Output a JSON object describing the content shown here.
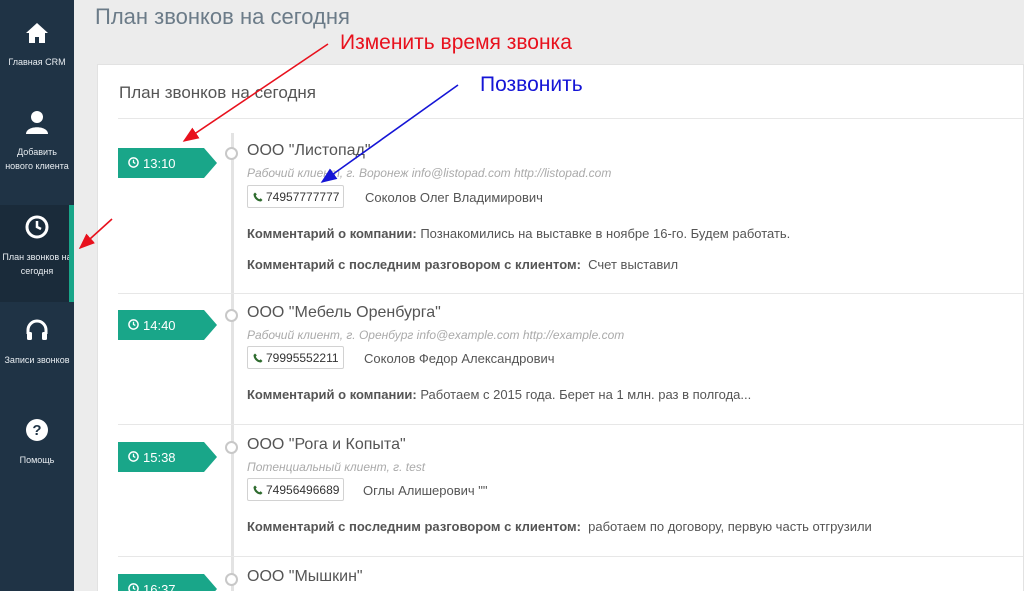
{
  "sidebar": {
    "items": [
      {
        "icon": "home-icon",
        "label": "Главная CRM"
      },
      {
        "icon": "user-icon",
        "label": "Добавить нового клиента"
      },
      {
        "icon": "clock-icon",
        "label": "План звонков на сегодня"
      },
      {
        "icon": "headphones-icon",
        "label": "Записи звонков"
      },
      {
        "icon": "question-icon",
        "label": "Помощь"
      }
    ],
    "accent": "#19a689",
    "background": "#1f3345"
  },
  "page": {
    "title": "План звонков на сегодня"
  },
  "panel": {
    "title": "План звонков на сегодня"
  },
  "annotations": {
    "change_time": "Изменить время звонка",
    "call": "Позвонить",
    "change_time_color": "#e8111d",
    "call_color": "#1515d6"
  },
  "calls": [
    {
      "time": "13:10",
      "company": "ООО \"Листопад\"",
      "meta": "Рабочий клиент, г. Воронеж info@listopad.com http://listopad.com",
      "phone": "74957777777",
      "contact": "Соколов Олег Владимирович",
      "company_comment_label": "Комментарий о компании:",
      "company_comment": "Познакомились на выставке в ноябре 16-го. Будем работать.",
      "last_comment_label": "Комментарий с последним разговором с клиентом:",
      "last_comment": "Счет выставил"
    },
    {
      "time": "14:40",
      "company": "ООО \"Мебель Оренбурга\"",
      "meta": "Рабочий клиент, г. Оренбург info@example.com http://example.com",
      "phone": "79995552211",
      "contact": "Соколов Федор Александрович",
      "company_comment_label": "Комментарий о компании:",
      "company_comment": "Работаем с 2015 года. Берет на 1 млн. раз в полгода..."
    },
    {
      "time": "15:38",
      "company": "ООО \"Рога и Копыта\"",
      "meta": "Потенциальный клиент, г. test",
      "phone": "74956496689",
      "contact": "Оглы Алишерович \"\"",
      "last_comment_label": "Комментарий с последним разговором с клиентом:",
      "last_comment": "работаем по договору, первую часть отгрузили"
    },
    {
      "time": "16:37",
      "company": "ООО \"Мышкин\""
    }
  ]
}
